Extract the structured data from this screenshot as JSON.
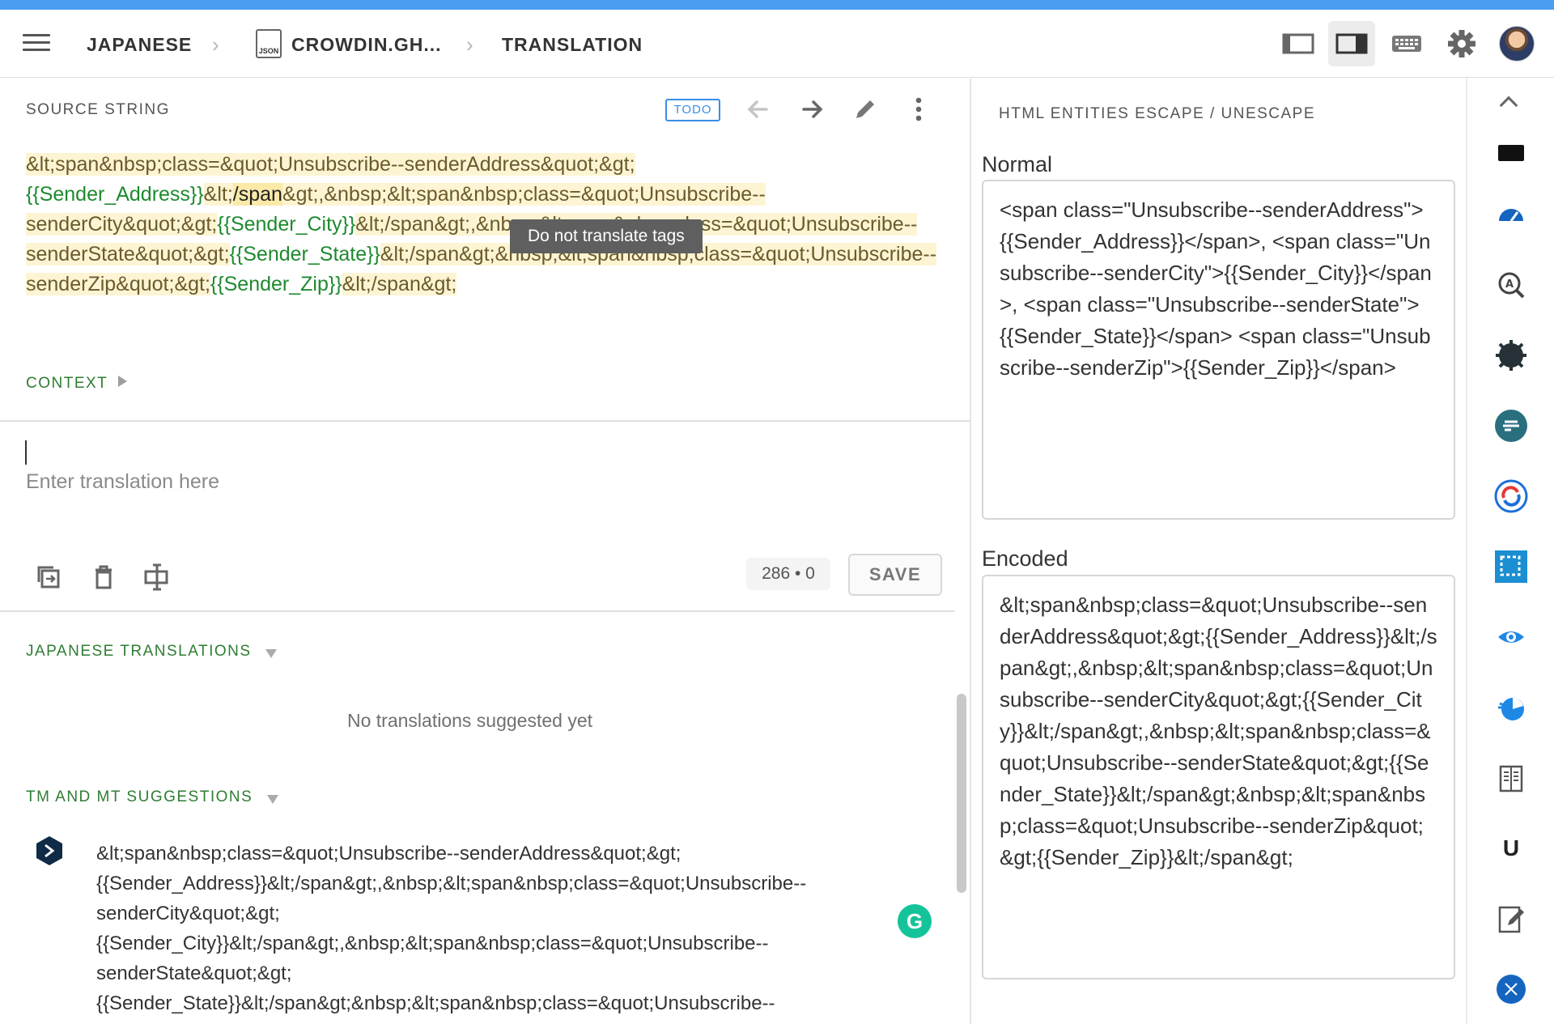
{
  "header": {
    "breadcrumb": {
      "language": "JAPANESE",
      "file": "CROWDIN.GH...",
      "file_icon_label": "JSON",
      "page": "TRANSLATION"
    },
    "icons": [
      "menu-icon",
      "chevron-right-icon",
      "json-file-icon",
      "layout-sidebar-icon",
      "layout-split-icon",
      "keyboard-icon",
      "gear-icon",
      "avatar"
    ]
  },
  "source": {
    "label": "SOURCE STRING",
    "status_badge": "TODO",
    "segments": [
      {
        "t": "&lt;span&nbsp;class=&quot;Unsubscribe--",
        "k": "hl"
      },
      {
        "t": "senderAddress&quot;&gt;",
        "k": "hl"
      },
      {
        "t": "{{Sender_Address}}",
        "k": "var"
      },
      {
        "t": "&lt;",
        "k": "hl"
      },
      {
        "t": "/span",
        "k": "tagdark"
      },
      {
        "t": "&gt;,&nbsp;&lt;span&nbsp;class=&quot;Unsub",
        "k": "hl"
      },
      {
        "t": "scribe--",
        "k": "hl"
      },
      {
        "t": "senderCity&quot;&gt;",
        "k": "hl"
      },
      {
        "t": "{{Sender_City}}",
        "k": "var"
      },
      {
        "t": "&lt;/span&gt;,&nbsp;&lt;span&nbsp;class=&quot;Unsubscribe--",
        "k": "hl"
      },
      {
        "t": "senderState&quot;&gt;",
        "k": "hl"
      },
      {
        "t": "{{Sender_State}}",
        "k": "var"
      },
      {
        "t": "&lt;/span&gt;&nbsp;&lt;span&nbsp;class=&quot;Unsubscribe--",
        "k": "hl"
      },
      {
        "t": "senderZip&quot;&gt;",
        "k": "hl"
      },
      {
        "t": "{{Sender_Zip}}",
        "k": "var"
      },
      {
        "t": "&lt;/span&gt;",
        "k": "hl"
      }
    ],
    "tooltip": "Do not translate tags",
    "context_label": "CONTEXT"
  },
  "editor": {
    "placeholder": "Enter translation here",
    "value": "",
    "counter": "286 • 0",
    "save_label": "SAVE"
  },
  "translations": {
    "label": "JAPANESE TRANSLATIONS",
    "empty_message": "No translations suggested yet"
  },
  "suggestions": {
    "label": "TM AND MT SUGGESTIONS",
    "engine_icon": "deepl-icon",
    "text": "&lt;span&nbsp;class=&quot;Unsubscribe--senderAddress&quot;&gt; {{Sender_Address}}&lt;/span&gt;,&nbsp;&lt;span&nbsp;class=&quot;Unsubscribe-- senderCity&quot;&gt; {{Sender_City}}&lt;/span&gt;,&nbsp;&lt;span&nbsp;class=&quot;Unsubscribe-- senderState&quot;&gt; {{Sender_State}}&lt;/span&gt;&nbsp;&lt;span&nbsp;class=&quot;Unsubscribe--"
  },
  "entities_panel": {
    "title": "HTML ENTITIES ESCAPE / UNESCAPE",
    "normal_label": "Normal",
    "normal_value": "<span class=\"Unsubscribe--senderAddress\">{{Sender_Address}}</span>, <span class=\"Unsubscribe--senderCity\">{{Sender_City}}</span>, <span class=\"Unsubscribe--senderState\">{{Sender_State}}</span> <span class=\"Unsubscribe--senderZip\">{{Sender_Zip}}</span>",
    "encoded_label": "Encoded",
    "encoded_value": "&lt;span&nbsp;class=&quot;Unsubscribe--senderAddress&quot;&gt;{{Sender_Address}}&lt;/span&gt;,&nbsp;&lt;span&nbsp;class=&quot;Unsubscribe--senderCity&quot;&gt;{{Sender_City}}&lt;/span&gt;,&nbsp;&lt;span&nbsp;class=&quot;Unsubscribe--senderState&quot;&gt;{{Sender_State}}&lt;/span&gt;&nbsp;&lt;span&nbsp;class=&quot;Unsubscribe--senderZip&quot;&gt;{{Sender_Zip}}&lt;/span&gt;"
  },
  "grammarly_icon": "G",
  "rail": {
    "u_label": "U",
    "icons": [
      "chevron-up-icon",
      "plugin-icon-1",
      "speedometer-icon",
      "search-a-icon",
      "gear-dark-icon",
      "tag-icon",
      "sync-icon",
      "selection-icon",
      "eye-icon",
      "chart-icon",
      "book-icon",
      "u-icon",
      "edit-note-icon",
      "x-icon"
    ]
  },
  "colors": {
    "accent": "#4a9df0",
    "variable_green": "#1e8a2e",
    "highlight_yellow": "#fdf4d3"
  }
}
